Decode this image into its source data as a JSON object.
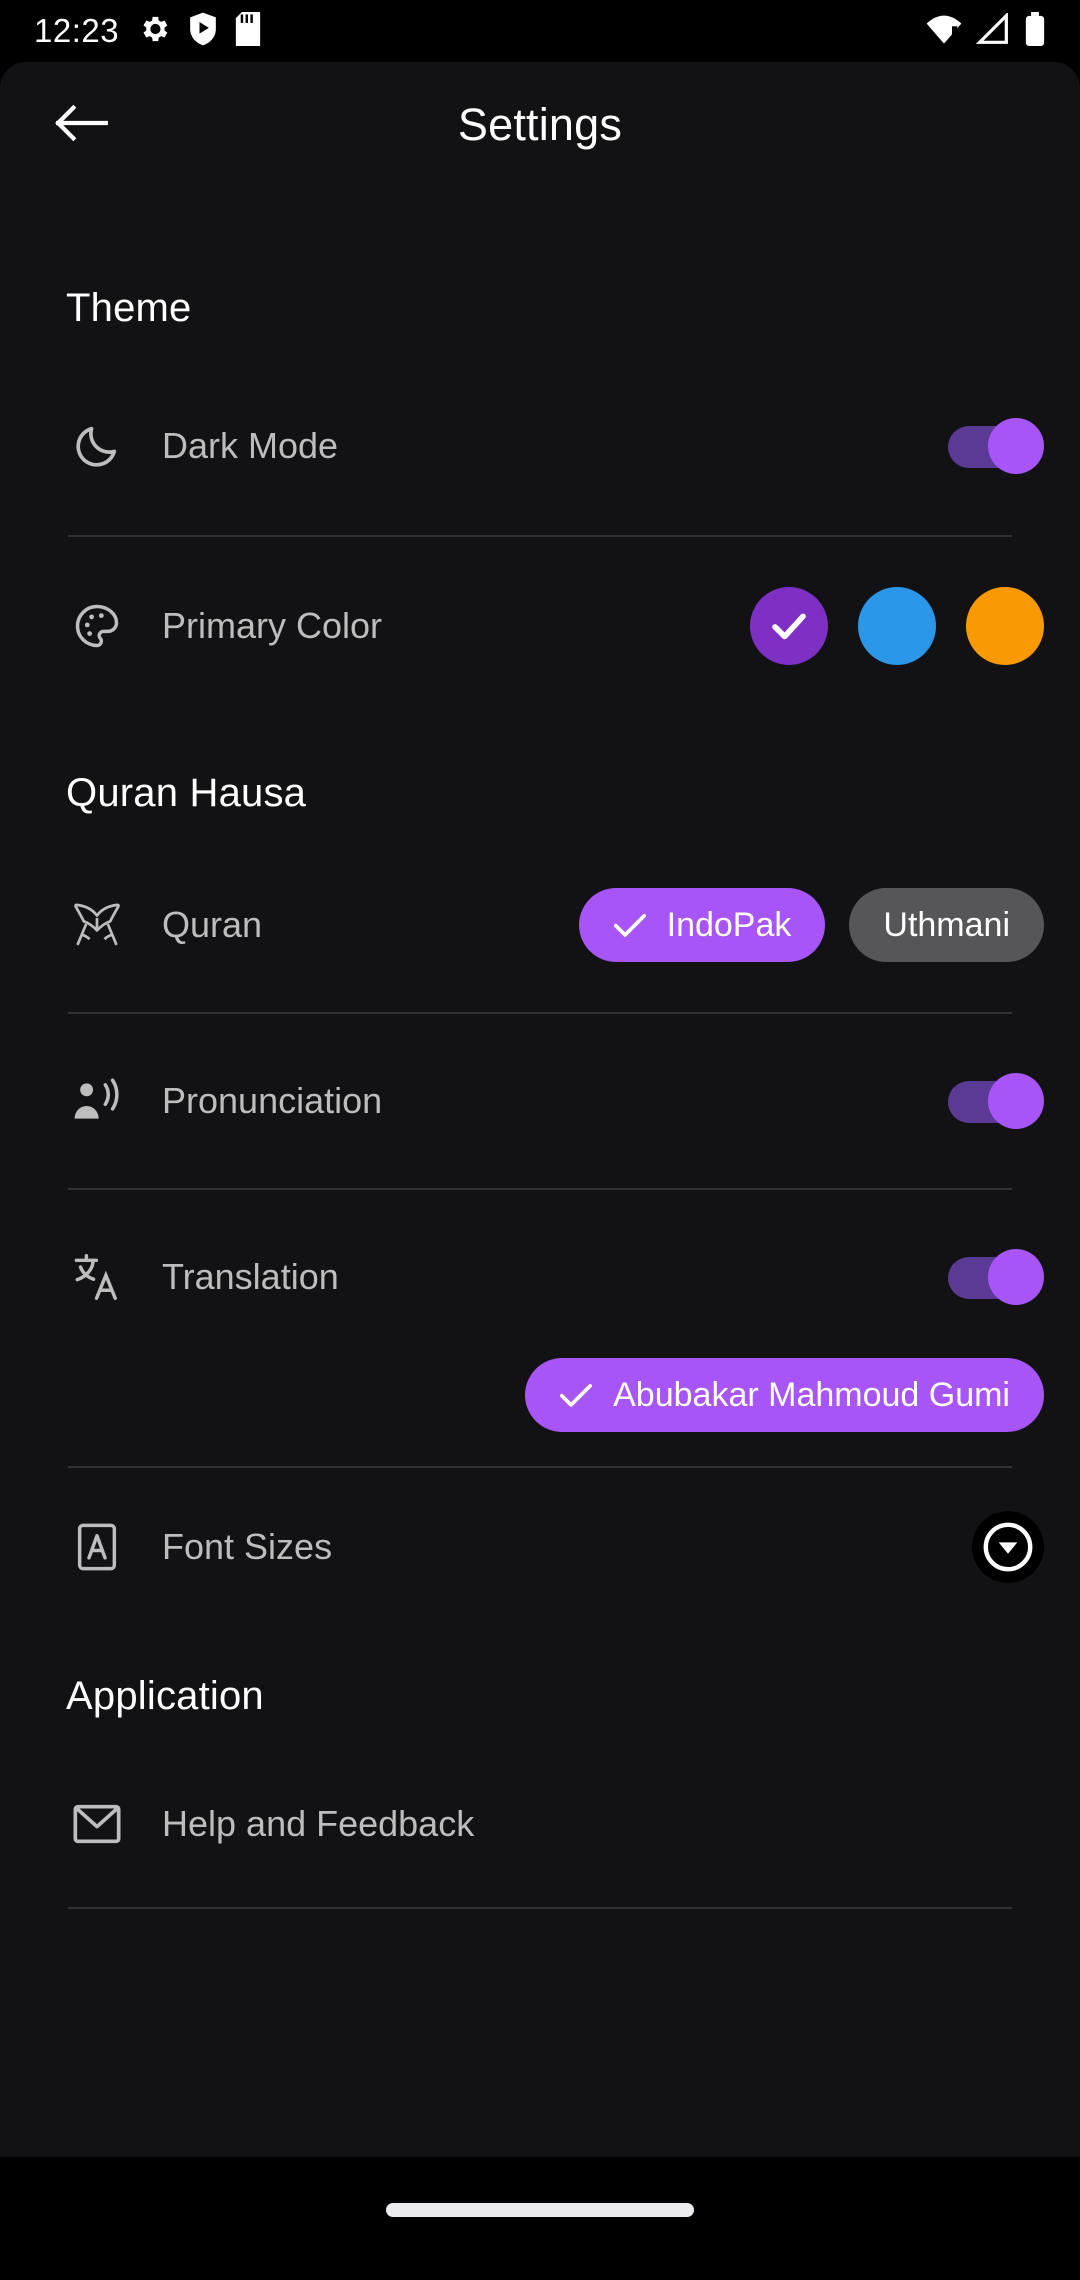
{
  "status_bar": {
    "time": "12:23",
    "left_icons": [
      "gear-icon",
      "play-protect-icon",
      "sd-card-icon"
    ],
    "right_icons": [
      "wifi-alert-icon",
      "signal-icon",
      "battery-icon"
    ]
  },
  "app_bar": {
    "back_icon": "arrow-left-icon",
    "title": "Settings"
  },
  "theme_section": {
    "title": "Theme",
    "dark_mode": {
      "icon": "moon-icon",
      "label": "Dark Mode",
      "enabled": "on"
    },
    "primary_color": {
      "icon": "palette-icon",
      "label": "Primary Color",
      "swatches": [
        {
          "name": "purple",
          "hex": "#7e2fc4",
          "selected": "yes"
        },
        {
          "name": "blue",
          "hex": "#2b97e8",
          "selected": "no"
        },
        {
          "name": "orange",
          "hex": "#f99a05",
          "selected": "no"
        }
      ]
    }
  },
  "quran_section": {
    "title": "Quran Hausa",
    "quran": {
      "icon": "quran-book-icon",
      "label": "Quran",
      "options": [
        {
          "label": "IndoPak",
          "selected": "yes"
        },
        {
          "label": "Uthmani",
          "selected": "no"
        }
      ]
    },
    "pronunciation": {
      "icon": "pronunciation-icon",
      "label": "Pronunciation",
      "enabled": "on"
    },
    "translation": {
      "icon": "translate-icon",
      "label": "Translation",
      "enabled": "on",
      "options": [
        {
          "label": "Abubakar Mahmoud Gumi",
          "selected": "yes"
        }
      ]
    },
    "font_sizes": {
      "icon": "font-size-icon",
      "label": "Font Sizes",
      "expand_icon": "chevron-down-circle-icon"
    }
  },
  "application_section": {
    "title": "Application",
    "help": {
      "icon": "mail-icon",
      "label": "Help and Feedback"
    }
  },
  "colors": {
    "accent": "#a855f7",
    "accent_track": "#5a3a94",
    "surface": "#121214",
    "chip_unselected": "#565658",
    "text_primary": "#ffffff",
    "text_secondary": "#bdbdbd",
    "divider": "#313134"
  },
  "navigation_bar": {
    "gesture_pill": "home-indicator"
  }
}
